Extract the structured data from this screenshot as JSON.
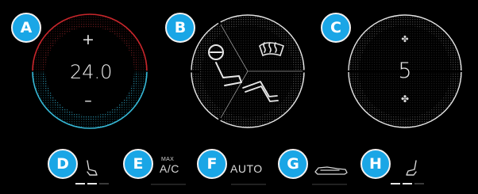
{
  "badges": {
    "a": "A",
    "b": "B",
    "c": "C",
    "d": "D",
    "e": "E",
    "f": "F",
    "g": "G",
    "h": "H"
  },
  "temperature": {
    "value": "24.0",
    "increase_label": "+",
    "decrease_label": "–"
  },
  "airflow": {
    "icons": [
      "driver-seat-airflow-icon",
      "windshield-defrost-icon"
    ]
  },
  "fan": {
    "level": "5",
    "up_icon": "✤",
    "down_icon": "✤"
  },
  "buttons": {
    "max_label": "MAX",
    "ac_label": "A/C",
    "auto_label": "AUTO",
    "left_seat_heat_level": 2,
    "right_seat_heat_level": 2,
    "seat_heat_levels_total": 3
  },
  "colors": {
    "hot": "#c8262b",
    "cold": "#36b8d6",
    "badge": "#1aa6e6",
    "active_indicator": "#e6e6e6",
    "inactive_indicator": "#3a3a3a"
  }
}
